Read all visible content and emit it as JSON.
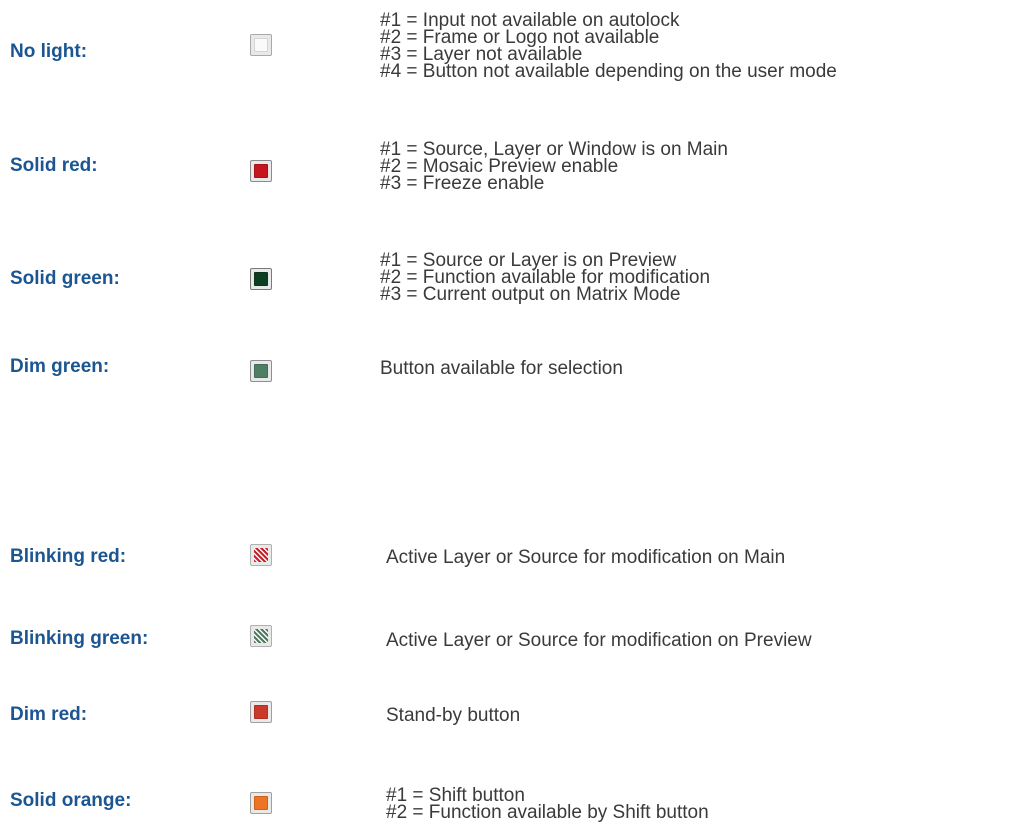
{
  "legend": [
    {
      "label": "No light:",
      "swatch": {
        "border": "#a9a9a9",
        "fill": "#fafafa",
        "pattern": "none"
      },
      "descriptions": [
        "#1 = Input not available on autolock",
        "#2 = Frame or Logo not available",
        "#3 = Layer not available",
        "#4 = Button not available depending on the user mode"
      ]
    },
    {
      "label": "Solid red:",
      "swatch": {
        "border": "#8c8c8c",
        "fill": "#c4161c",
        "pattern": "none"
      },
      "descriptions": [
        "#1 = Source, Layer or Window is on Main",
        "#2 = Mosaic Preview enable",
        "#3 = Freeze enable"
      ]
    },
    {
      "label": "Solid green:",
      "swatch": {
        "border": "#7a7a7a",
        "fill": "#0c3f22",
        "pattern": "none"
      },
      "descriptions": [
        "#1 = Source or Layer is on Preview",
        "#2 = Function available for modification",
        "#3 = Current output on Matrix Mode"
      ]
    },
    {
      "label": "Dim green:",
      "swatch": {
        "border": "#8f8f8f",
        "fill": "#4f7f63",
        "pattern": "none"
      },
      "descriptions": [
        "Button available for selection"
      ]
    },
    {
      "label": "Blinking red:",
      "swatch": {
        "border": "#b0b0b0",
        "fill": "#c7202a",
        "pattern": "stripes-light"
      },
      "descriptions": [
        "Active Layer or Source for modification on Main"
      ]
    },
    {
      "label": "Blinking green:",
      "swatch": {
        "border": "#b0b0b0",
        "fill": "#4e7a5d",
        "pattern": "stripes-light"
      },
      "descriptions": [
        "Active Layer or Source for modification on Preview"
      ]
    },
    {
      "label": "Dim red:",
      "swatch": {
        "border": "#a0a0a0",
        "fill": "#c93a2b",
        "pattern": "none"
      },
      "descriptions": [
        "Stand-by button"
      ]
    },
    {
      "label": "Solid orange:",
      "swatch": {
        "border": "#a0a0a0",
        "fill": "#ee7424",
        "pattern": "none"
      },
      "descriptions": [
        "#1 = Shift button",
        "#2 = Function available by Shift button"
      ]
    }
  ]
}
